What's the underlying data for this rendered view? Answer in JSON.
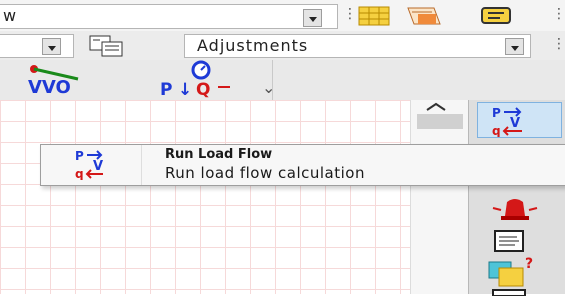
{
  "toolbar": {
    "combo_top_text": "w",
    "combo_adjustments_text": "Adjustments"
  },
  "menu": {
    "item_title": "Run Load Flow",
    "item_description": "Run load flow calculation"
  },
  "icons": {
    "network_vvo": "vvo-icon",
    "pq_control": "pq-icon",
    "load_flow": "load-flow-icon",
    "alarm": "alarm-bell-icon",
    "document": "document-icon",
    "help_docs": "help-docs-icon"
  },
  "colors": {
    "accent_blue": "#1e3ad6",
    "accent_red": "#d41818",
    "grid_line": "#f6d9d9"
  }
}
